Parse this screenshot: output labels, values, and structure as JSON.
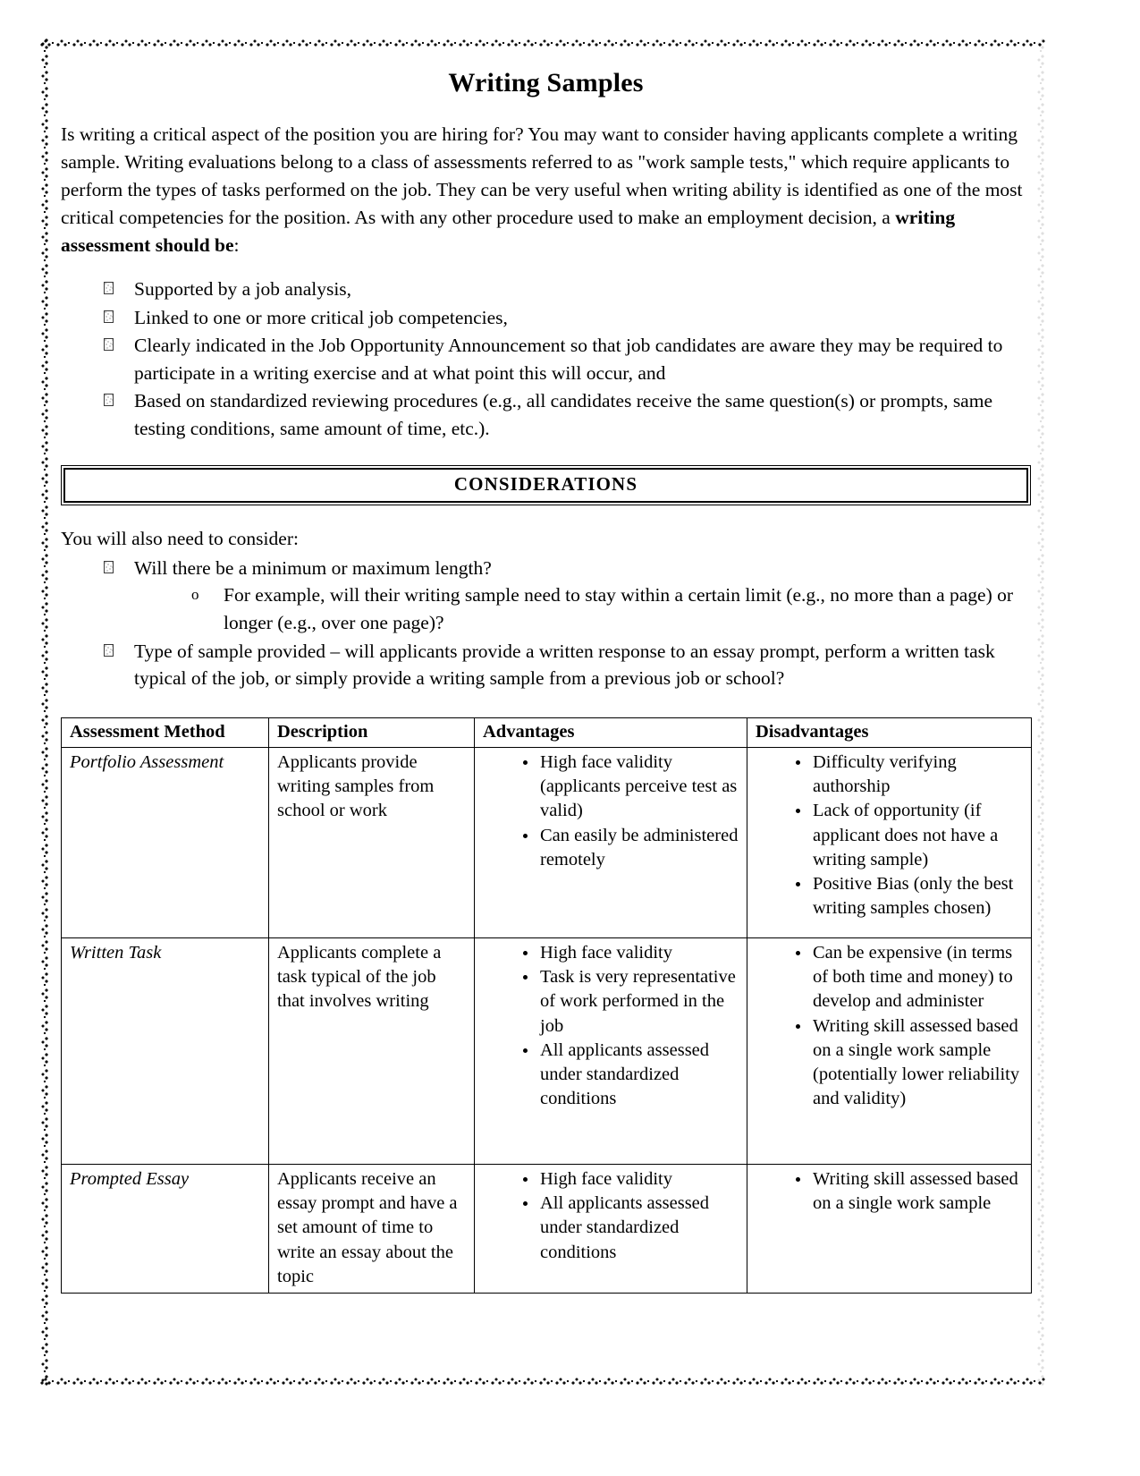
{
  "document": {
    "title": "Writing Samples",
    "intro_before_bold": "Is writing a critical aspect of the position you are hiring for?  You may want to consider having applicants complete a writing sample.  Writing evaluations belong to a class of assessments referred to as \"work sample tests,\" which require applicants to perform the types of tasks performed on the job.  They can be very useful when writing ability is identified as one of the most critical competencies for the position.  As with any other procedure used to make an employment decision, a ",
    "intro_bold": "writing assessment should be",
    "intro_after_bold": ":",
    "requirements": [
      "Supported by a job analysis,",
      "Linked to one or more critical job competencies,",
      "Clearly indicated in the Job Opportunity Announcement so that job candidates are aware they may be required to participate in a writing exercise and at what point this will occur, and",
      "Based on standardized reviewing procedures (e.g., all candidates receive the same question(s) or prompts, same testing conditions, same amount of time, etc.)."
    ]
  },
  "considerations": {
    "banner_label": "CONSIDERATIONS",
    "lead": "You will also need to consider:",
    "item_1": "Will there be a minimum or maximum length?",
    "sub_marker": "o",
    "item_1_sub": "For example, will their writing sample need to stay within a certain limit (e.g., no more than a page) or longer (e.g., over one page)?",
    "item_2": "Type of sample provided – will applicants provide a written response to an essay prompt, perform a written task typical of the job, or simply provide a writing sample from a previous job or school?"
  },
  "table": {
    "headers": {
      "method": "Assessment Method",
      "description": "Description",
      "advantages": "Advantages",
      "disadvantages": "Disadvantages"
    },
    "rows": [
      {
        "method": "Portfolio Assessment",
        "description": "Applicants provide writing samples from school or work",
        "advantages": [
          "High face validity (applicants perceive test as valid)",
          "Can easily be administered remotely"
        ],
        "disadvantages": [
          "Difficulty verifying authorship",
          "Lack of opportunity (if applicant does not have a writing sample)",
          "Positive Bias (only the best writing samples chosen)"
        ]
      },
      {
        "method": "Written Task",
        "description": "Applicants complete a task typical of the job that involves writing",
        "advantages": [
          "High face validity",
          "Task is very representative of work performed in the job",
          "All applicants assessed under standardized conditions"
        ],
        "disadvantages": [
          "Can be expensive (in terms of both time and money) to develop and administer",
          "Writing skill assessed based on a single work sample (potentially lower reliability and validity)"
        ]
      },
      {
        "method": "Prompted Essay",
        "description": "Applicants receive an essay prompt and have a set amount of time to write an essay about the topic",
        "advantages": [
          "High face validity",
          "All applicants assessed under standardized conditions"
        ],
        "disadvantages": [
          "Writing skill assessed based on a single work sample"
        ]
      }
    ]
  },
  "icons": {
    "list_bullet": "broken-image-bullet-icon",
    "sub_bullet": "circle-bullet-icon",
    "disc_bullet": "disc-bullet-icon",
    "page_border": "decorative-wave-border-icon"
  }
}
